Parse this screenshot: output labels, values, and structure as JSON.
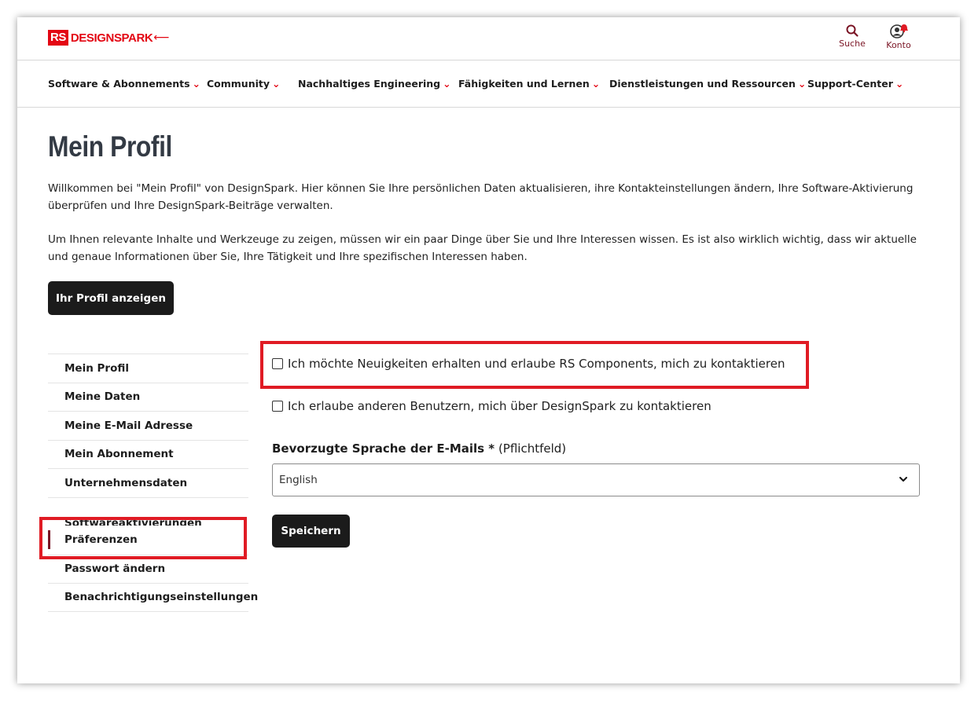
{
  "header": {
    "logo_rs": "RS",
    "logo_text": "DESIGNSPARK",
    "search_label": "Suche",
    "account_label": "Konto",
    "icons": [
      "search-icon",
      "account-icon",
      "notification-bell-icon"
    ]
  },
  "nav": {
    "items": [
      {
        "label": "Software & Abonnements"
      },
      {
        "label": "Community"
      },
      {
        "label": "Nachhaltiges Engineering"
      },
      {
        "label": "Fähigkeiten und Lernen"
      },
      {
        "label": "Dienstleistungen und Ressourcen"
      },
      {
        "label": "Support-Center"
      }
    ]
  },
  "page": {
    "title": "Mein Profil",
    "intro1": "Willkommen bei \"Mein Profil\" von DesignSpark. Hier können Sie Ihre persönlichen Daten aktualisieren, ihre Kontakteinstellungen ändern, Ihre Software-Aktivierung überprüfen und Ihre DesignSpark-Beiträge verwalten.",
    "intro2": "Um Ihnen relevante Inhalte und Werkzeuge zu zeigen, müssen wir ein paar Dinge über Sie und Ihre Interessen wissen. Es ist also wirklich wichtig, dass wir aktuelle und genaue Informationen über Sie, Ihre Tätigkeit und Ihre spezifischen Interessen haben.",
    "view_profile_button": "Ihr Profil anzeigen"
  },
  "sidebar": {
    "items": [
      {
        "label": "Mein Profil"
      },
      {
        "label": "Meine Daten"
      },
      {
        "label": "Meine E-Mail Adresse"
      },
      {
        "label": "Mein Abonnement"
      },
      {
        "label": "Unternehmensdaten"
      },
      {
        "label": "Softwareaktivierungen"
      },
      {
        "label": "Präferenzen",
        "active": true
      },
      {
        "label": "Passwort ändern"
      },
      {
        "label": "Benachrichtigungseinstellungen"
      }
    ]
  },
  "preferences": {
    "checkbox1": {
      "label": "Ich möchte Neuigkeiten erhalten und erlaube RS Components, mich zu kontaktieren",
      "checked": false
    },
    "checkbox2": {
      "label": "Ich erlaube anderen Benutzern, mich über DesignSpark zu kontaktieren",
      "checked": false
    },
    "language_label": "Bevorzugte Sprache der E-Mails *",
    "language_required": "(Pflichtfeld)",
    "language_value": "English",
    "save_button": "Speichern"
  },
  "colors": {
    "brand_red": "#e30613",
    "accent_maroon": "#7a1424",
    "highlight_red": "#e01b24",
    "button_dark": "#1b1b1b"
  }
}
